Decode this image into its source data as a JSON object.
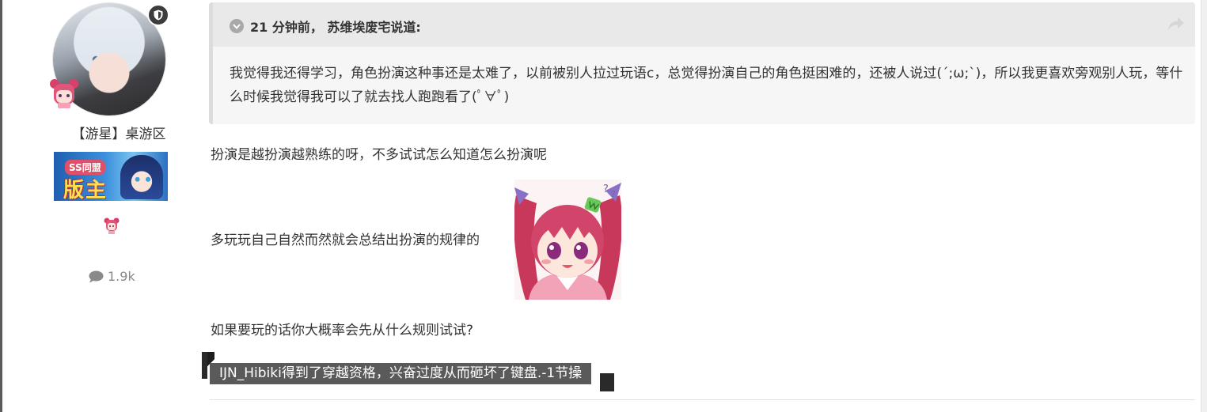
{
  "author": {
    "group_name": "【游星】桌游区",
    "banner_tag": "SS同盟",
    "banner_title": "版主",
    "post_count": "1.9k"
  },
  "quote": {
    "citation": "21 分钟前， 苏维埃废宅说道:",
    "body": "我觉得我还得学习，角色扮演这种事还是太难了，以前被别人拉过玩语c，总觉得扮演自己的角色挺困难的，还被人说过(´;ω;`)，所以我更喜欢旁观别人玩，等什么时候我觉得我可以了就去找人跑跑看了(ﾟ∀ﾟ)"
  },
  "post": {
    "paragraph_1": "扮演是越扮演越熟练的呀，不多试试怎么知道怎么扮演呢",
    "paragraph_2": "多玩玩自己自然而然就会总结出扮演的规律的",
    "paragraph_3": "如果要玩的话你大概率会先从什么规则试试?",
    "moderation_note": "IJN_Hibiki得到了穿越资格，兴奋过度从而砸坏了键盘.-1节操"
  },
  "icons": {
    "mod_badge": "shield-icon",
    "quote_toggle": "chevron-down-circle-icon",
    "share": "share-arrow-icon",
    "post_count": "comment-icon"
  },
  "colors": {
    "quote_header_bg": "#e9e9e9",
    "quote_bg": "#f6f6f6",
    "moderation_bg": "#5a5a5a",
    "text": "#333333",
    "muted": "#888888"
  }
}
